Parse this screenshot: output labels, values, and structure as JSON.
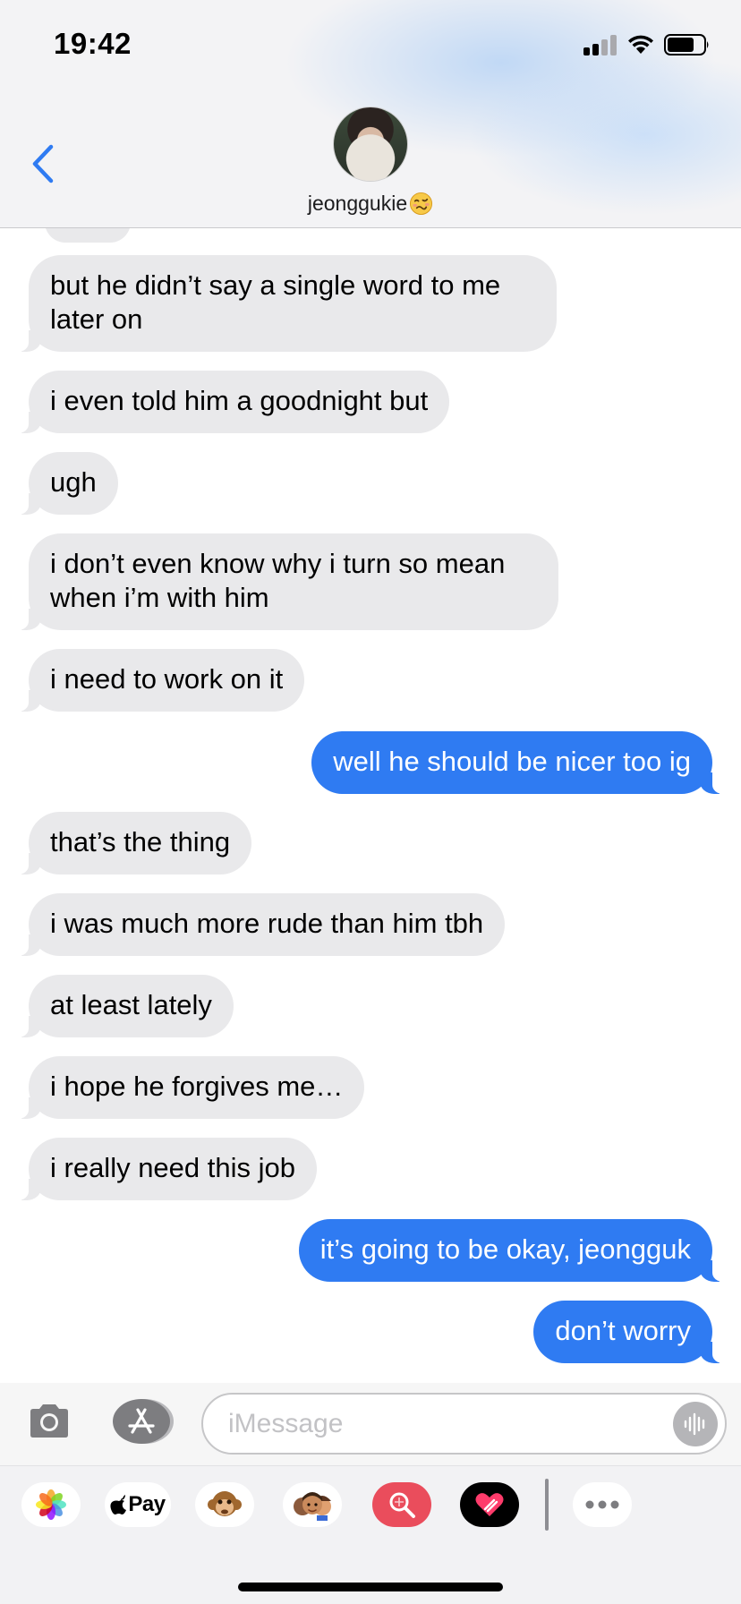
{
  "status_bar": {
    "time": "19:42"
  },
  "header": {
    "contact_name": "jeonggukie",
    "contact_emoji_icon": "woozy-face-icon"
  },
  "messages": [
    {
      "direction": "in",
      "text": "but he didn’t say a single word to me later on"
    },
    {
      "direction": "in",
      "text": "i even told him a goodnight but"
    },
    {
      "direction": "in",
      "text": "ugh"
    },
    {
      "direction": "in",
      "text": "i don’t even know why i turn so mean when i’m with him"
    },
    {
      "direction": "in",
      "text": "i need to work on it"
    },
    {
      "direction": "out",
      "text": "well he should be nicer too ig"
    },
    {
      "direction": "in",
      "text": "that’s the thing"
    },
    {
      "direction": "in",
      "text": "i was much more rude than him tbh"
    },
    {
      "direction": "in",
      "text": "at least lately"
    },
    {
      "direction": "in",
      "text": "i hope he forgives me…"
    },
    {
      "direction": "in",
      "text": "i really need this job"
    },
    {
      "direction": "out",
      "text": "it’s going to be okay, jeongguk"
    },
    {
      "direction": "out",
      "text": "don’t worry"
    }
  ],
  "input_bar": {
    "placeholder": "iMessage",
    "value": ""
  },
  "app_drawer": {
    "apple_pay_label": "Pay",
    "apps": [
      "photos-icon",
      "apple-pay-icon",
      "monkey-icon",
      "memoji-icon",
      "image-search-icon",
      "digital-touch-icon",
      "more-apps-icon"
    ]
  },
  "colors": {
    "incoming_bubble": "#e9e9eb",
    "outgoing_bubble": "#2f7bf2",
    "accent": "#2f7bf2"
  }
}
